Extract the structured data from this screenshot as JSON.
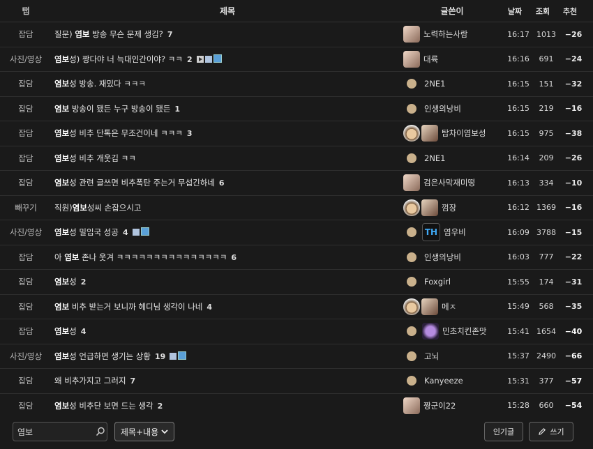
{
  "header": {
    "cat": "탭",
    "title": "제목",
    "author": "글쓴이",
    "date": "날짜",
    "views": "조회",
    "rec": "추천"
  },
  "rows": [
    {
      "cat": "잡담",
      "pre": "질문) ",
      "kw": "염보",
      "post": " 방송 무슨 문제 생김?",
      "comments": "7",
      "author": "노력하는사람",
      "date": "16:17",
      "views": "1013",
      "rec": "−26",
      "rec_color": "#e8e8e8",
      "avatar": "pic",
      "icons": []
    },
    {
      "cat": "사진/영상",
      "pre": "",
      "kw": "염보",
      "post": "성) 짱다야 너 늑대인간이야? ㅋㅋ",
      "comments": "2",
      "author": "대륙",
      "date": "16:16",
      "views": "691",
      "rec": "−24",
      "rec_color": "#e8e8e8",
      "avatar": "pic",
      "icons": [
        "play",
        "doc",
        "img"
      ]
    },
    {
      "cat": "잡담",
      "pre": "",
      "kw": "염보",
      "post": "성 방송. 재밌다 ㅋㅋㅋ",
      "comments": "",
      "author": "2NE1",
      "date": "16:15",
      "views": "151",
      "rec": "−32",
      "rec_color": "#e8e8e8",
      "avatar": "dot",
      "icons": []
    },
    {
      "cat": "잡담",
      "pre": "",
      "kw": "염보",
      "post": " 방송이 됐든 누구 방송이 됐든",
      "comments": "1",
      "author": "인생의낭비",
      "date": "16:15",
      "views": "219",
      "rec": "−16",
      "rec_color": "#e8e8e8",
      "avatar": "dot",
      "icons": []
    },
    {
      "cat": "잡담",
      "pre": "",
      "kw": "염보",
      "post": "성 비추 단톡은 무조건이네 ㅋㅋㅋ",
      "comments": "3",
      "author": "탑차이염보성",
      "date": "16:15",
      "views": "975",
      "rec": "−38",
      "rec_color": "#e8e8e8",
      "avatar": "dog",
      "icons": []
    },
    {
      "cat": "잡담",
      "pre": "",
      "kw": "염보",
      "post": "성 비추 개웃김 ㅋㅋ",
      "comments": "",
      "author": "2NE1",
      "date": "16:14",
      "views": "209",
      "rec": "−26",
      "rec_color": "#e8e8e8",
      "avatar": "dot",
      "icons": []
    },
    {
      "cat": "잡담",
      "pre": "",
      "kw": "염보",
      "post": "성 관련 글쓰면 비추폭탄 주는거 무섭긴하네",
      "comments": "6",
      "author": "검은사막재미떵",
      "date": "16:13",
      "views": "334",
      "rec": "−10",
      "rec_color": "#e8e8e8",
      "avatar": "pic",
      "icons": []
    },
    {
      "cat": "빼꾸기",
      "pre": "직원)",
      "kw": "염보",
      "post": "성씨 손잡으시고",
      "comments": "",
      "author": "껌장",
      "date": "16:12",
      "views": "1369",
      "rec": "−16",
      "rec_color": "#e8e8e8",
      "avatar": "dog",
      "icons": []
    },
    {
      "cat": "사진/영상",
      "pre": "",
      "kw": "염보",
      "post": "성 밀입국 성공",
      "comments": "4",
      "author": "염우비",
      "date": "16:09",
      "views": "3788",
      "rec": "−15",
      "rec_color": "#e8e8e8",
      "avatar": "th",
      "icons": [
        "doc",
        "img"
      ]
    },
    {
      "cat": "잡담",
      "pre": "아 ",
      "kw": "염보",
      "post": " 존나 웃겨 ㅋㅋㅋㅋㅋㅋㅋㅋㅋㅋㅋㅋㅋㅋㅋ",
      "comments": "6",
      "author": "인생의낭비",
      "date": "16:03",
      "views": "777",
      "rec": "−22",
      "rec_color": "#e8e8e8",
      "avatar": "dot",
      "icons": []
    },
    {
      "cat": "잡담",
      "pre": "",
      "kw": "염보",
      "post": "성",
      "comments": "2",
      "author": "Foxgirl",
      "date": "15:55",
      "views": "174",
      "rec": "−31",
      "rec_color": "#e8e8e8",
      "avatar": "dot",
      "icons": []
    },
    {
      "cat": "잡담",
      "pre": "",
      "kw": "염보",
      "post": " 비추 받는거 보니까 헤디님 생각이 나네",
      "comments": "4",
      "author": "메ㅈ",
      "date": "15:49",
      "views": "568",
      "rec": "−35",
      "rec_color": "#e8e8e8",
      "avatar": "dog",
      "icons": []
    },
    {
      "cat": "잡담",
      "pre": "",
      "kw": "염보",
      "post": "성",
      "comments": "4",
      "author": "민초치킨존맛",
      "date": "15:41",
      "views": "1654",
      "rec": "−40",
      "rec_color": "#ffffff",
      "avatar": "purple",
      "icons": []
    },
    {
      "cat": "사진/영상",
      "pre": "",
      "kw": "염보",
      "post": "성 언급하면 생기는 상황",
      "comments": "19",
      "author": "고뇌",
      "date": "15:37",
      "views": "2490",
      "rec": "−66",
      "rec_color": "#ffffff",
      "avatar": "dot",
      "icons": [
        "doc",
        "img"
      ]
    },
    {
      "cat": "잡담",
      "pre": "왜 비추가지고 그러지",
      "kw": "",
      "post": "",
      "comments": "7",
      "author": "Kanyeeze",
      "date": "15:31",
      "views": "377",
      "rec": "−57",
      "rec_color": "#ffffff",
      "avatar": "dot",
      "icons": []
    },
    {
      "cat": "잡담",
      "pre": "",
      "kw": "염보",
      "post": "성 비추단 보면 드는 생각",
      "comments": "2",
      "author": "짱군이22",
      "date": "15:28",
      "views": "660",
      "rec": "−54",
      "rec_color": "#ffffff",
      "avatar": "pic",
      "icons": []
    }
  ],
  "footer": {
    "search_value": "염보",
    "search_type": "제목+내용",
    "popular_label": "인기글",
    "write_label": "쓰기"
  },
  "colors": {
    "background": "#1a1a1a",
    "keyword": "#ffffff",
    "text": "#d8d8d8"
  }
}
